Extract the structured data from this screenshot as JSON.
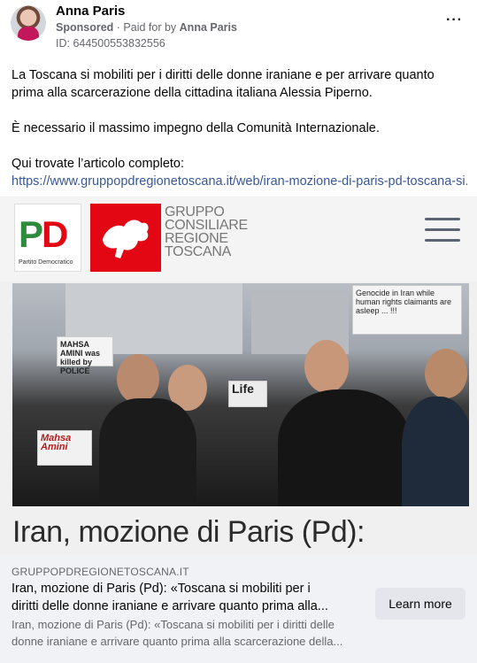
{
  "post": {
    "author": "Anna Paris",
    "sponsored": "Sponsored",
    "paid_for_prefix": "· Paid for by",
    "paid_for_name": "Anna Paris",
    "id": "ID: 644500553832556",
    "more": "···",
    "paragraphs": [
      "La Toscana si mobiliti per i diritti delle donne iraniane e per arrivare quanto prima alla scarcerazione della cittadina italiana Alessia Piperno.",
      "È necessario il massimo impegno della Comunità Internazionale.",
      "Qui trovate l’articolo completo:"
    ],
    "link": "https://www.gruppopdregionetoscana.it/web/iran-mozione-di-paris-pd-toscana-si..."
  },
  "card": {
    "pd_logo_caption": "Partito Democratico",
    "group_text": [
      "GRUPPO",
      "CONSILIARE",
      "REGIONE",
      "TOSCANA"
    ],
    "headline": "Iran, mozione di Paris (Pd):",
    "signs": [
      "Genocide in Iran while human rights claimants are asleep ... !!!",
      "MAHSA AMINI was killed by POLICE",
      "Mahsa Amini",
      "Life"
    ]
  },
  "preview": {
    "domain": "GRUPPOPDREGIONETOSCANA.IT",
    "title_line1": "Iran, mozione di Paris (Pd): «Toscana si mobiliti per i",
    "title_line2": "diritti delle donne iraniane e arrivare quanto prima alla...",
    "desc_line1": "Iran, mozione di Paris (Pd): «Toscana si mobiliti per i diritti delle",
    "desc_line2": "donne iraniane e arrivare quanto prima alla scarcerazione della...",
    "cta": "Learn more"
  },
  "colors": {
    "link": "#385898",
    "pd_green": "#2e8b3b",
    "pd_red": "#e30613",
    "button_bg": "#e4e6eb",
    "preview_bg": "#f0f2f5"
  }
}
